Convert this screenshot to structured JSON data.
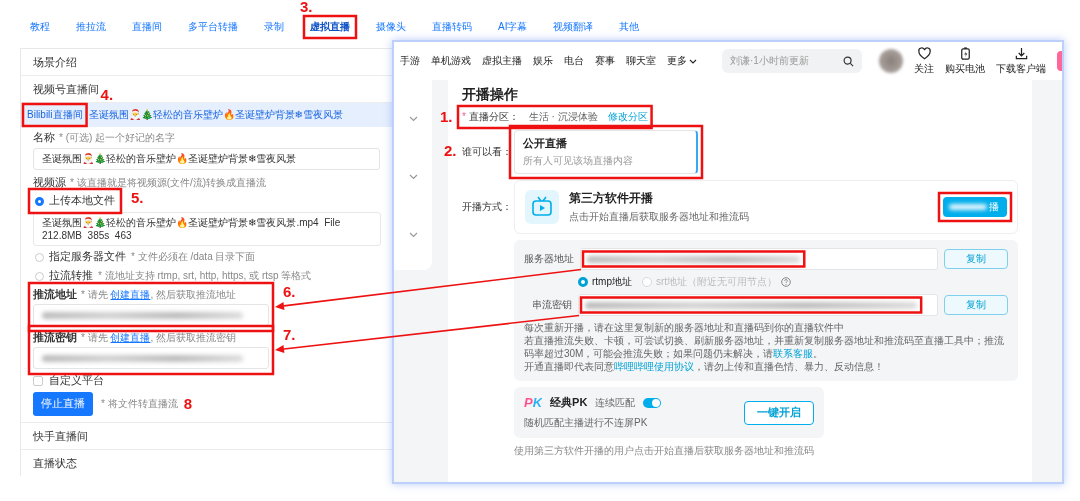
{
  "top_tabs": [
    {
      "label": "教程",
      "selected": false
    },
    {
      "label": "推拉流",
      "selected": false
    },
    {
      "label": "直播间",
      "selected": false
    },
    {
      "label": "多平台转播",
      "selected": false
    },
    {
      "label": "录制",
      "selected": false
    },
    {
      "label": "虚拟直播",
      "selected": true
    },
    {
      "label": "摄像头",
      "selected": false
    },
    {
      "label": "直播转码",
      "selected": false
    },
    {
      "label": "AI字幕",
      "selected": false
    },
    {
      "label": "视频翻译",
      "selected": false
    },
    {
      "label": "其他",
      "selected": false
    }
  ],
  "scene_panel": {
    "sections": [
      {
        "title": "场景介绍"
      },
      {
        "title": "视频号直播间"
      }
    ],
    "active_room": {
      "platform": "Bilibili直播间",
      "title": "圣诞氛围🎅🎄轻松的音乐壁炉🔥圣诞壁炉背景❄雪夜风景"
    },
    "name_field": {
      "label": "名称",
      "hint": "* (可选) 起一个好记的名字",
      "value": "圣诞氛围🎅🎄轻松的音乐壁炉🔥圣诞壁炉背景❄雪夜风景"
    },
    "video_source": {
      "label": "视频源",
      "hint": "* 该直播就是将视频源(文件/流)转换成直播流",
      "options": [
        {
          "label": "上传本地文件",
          "selected": true,
          "file_info": "圣诞氛围🎅🎄轻松的音乐壁炉🔥圣诞壁炉背景❄雪夜风景.mp4  File  212.8MB  385s  463"
        },
        {
          "label": "指定服务器文件",
          "selected": false,
          "hint": "* 文件必须在 /data 目录下面"
        },
        {
          "label": "拉流转推",
          "selected": false,
          "hint": "* 流地址支持 rtmp, srt, http, https, 或 rtsp 等格式"
        }
      ]
    },
    "push_url": {
      "label": "推流地址",
      "hint_before": "* 请先 ",
      "link": "创建直播",
      "hint_after": ", 然后获取推流地址"
    },
    "push_key": {
      "label": "推流密钥",
      "hint_before": "* 请先 ",
      "link": "创建直播",
      "hint_after": ", 然后获取推流密钥"
    },
    "custom_platform": {
      "label": "自定义平台",
      "checked": false
    },
    "stop_button": "停止直播",
    "stop_note": "* 将文件转直播流",
    "more_sections": [
      {
        "title": "快手直播间"
      },
      {
        "title": "直播状态"
      }
    ]
  },
  "bili_window": {
    "nav": [
      "手游",
      "单机游戏",
      "虚拟主播",
      "娱乐",
      "电台",
      "赛事",
      "聊天室",
      "更多"
    ],
    "search": {
      "placeholder": "刘谦·1小时前更新"
    },
    "actions": [
      {
        "kind": "heart",
        "label": "关注"
      },
      {
        "kind": "battery",
        "label": "购买电池"
      },
      {
        "kind": "download",
        "label": "下载客户端"
      }
    ],
    "title": "开播操作",
    "category": {
      "required_mark": "*",
      "label": "直播分区：",
      "value": "生活 · 沉浸体验",
      "link": "修改分区"
    },
    "visibility": {
      "label": "谁可以看：",
      "option": "公开直播",
      "desc": "所有人可见该场直播内容"
    },
    "method": {
      "label": "开播方式：",
      "name": "第三方软件开播",
      "desc": "点击开始直播后获取服务器地址和推流码",
      "button": "播"
    },
    "server": {
      "label": "服务器地址",
      "copy": "复制"
    },
    "protocols": [
      {
        "label": "rtmp地址",
        "selected": true,
        "disabled": false
      },
      {
        "label": "srt地址（附近无可用节点）",
        "selected": false,
        "disabled": true
      }
    ],
    "stream_key": {
      "label": "串流密钥",
      "copy": "复制"
    },
    "notes": [
      {
        "text": "每次重新开播，请在这里复制新的服务器地址和直播码到你的直播软件中"
      },
      {
        "text": "若直播推流失败、卡顿，可尝试切换、刷新服务器地址，并重新复制服务器地址和推流码至直播工具中；推流码率超过30M，可能会推流失败；如果问题仍未解决，请",
        "link": "联系客服",
        "after": "。"
      },
      {
        "text": "开通直播即代表同意",
        "link": "哔哩哔哩使用协议",
        "after": "，请勿上传和直播色情、暴力、反动信息！"
      }
    ],
    "pk": {
      "logo": "PK",
      "title": "经典PK",
      "toggle_label": "连续匹配",
      "toggle_on": true,
      "desc": "随机匹配主播进行不连屏PK",
      "button": "一键开启"
    },
    "footer": "使用第三方软件开播的用户点击开始直播后获取服务器地址和推流码"
  },
  "annotations": [
    {
      "kind": "tab",
      "label": "3.",
      "boxed": true
    },
    {
      "kind": "room",
      "label": "4.",
      "boxed": true
    },
    {
      "kind": "category",
      "label": "1.",
      "boxed": true
    },
    {
      "kind": "visibility",
      "label": "2.",
      "boxed": true
    },
    {
      "kind": "method",
      "boxed": true
    },
    {
      "kind": "server",
      "boxed": true
    },
    {
      "kind": "key",
      "boxed": true
    },
    {
      "kind": "upload",
      "label": "5.",
      "boxed": true
    },
    {
      "kind": "pushurl",
      "label": "6.",
      "boxed": true,
      "arrow": true
    },
    {
      "kind": "pushkey",
      "label": "7.",
      "boxed": true,
      "arrow": true
    },
    {
      "kind": "note",
      "label": "8",
      "boxed": false
    }
  ]
}
